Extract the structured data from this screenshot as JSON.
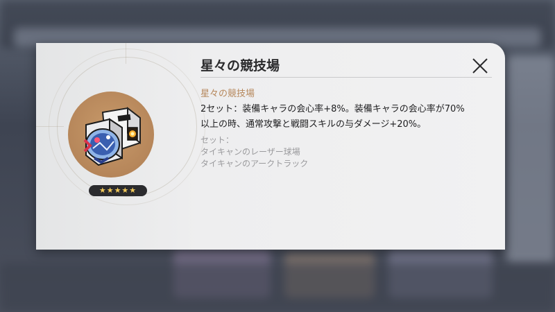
{
  "dialog": {
    "title": "星々の競技場",
    "close_icon": "close-icon",
    "subtitle": "星々の競技場",
    "effect_line1": "2セット：装備キャラの会心率+8%。装備キャラの会心率が70%",
    "effect_line2": "以上の時、通常攻撃と戦闘スキルの与ダメージ+20%。",
    "set_label": "セット：",
    "set_items": [
      "タイキャンのレーザー球場",
      "タイキャンのアークトラック"
    ]
  },
  "item": {
    "icon": "relic-planar-icon",
    "rarity": 5,
    "rarity_stars": "★★★★★"
  },
  "colors": {
    "accent": "#b5865a",
    "item_bg": "#b6865a",
    "star": "#f2c95a"
  }
}
